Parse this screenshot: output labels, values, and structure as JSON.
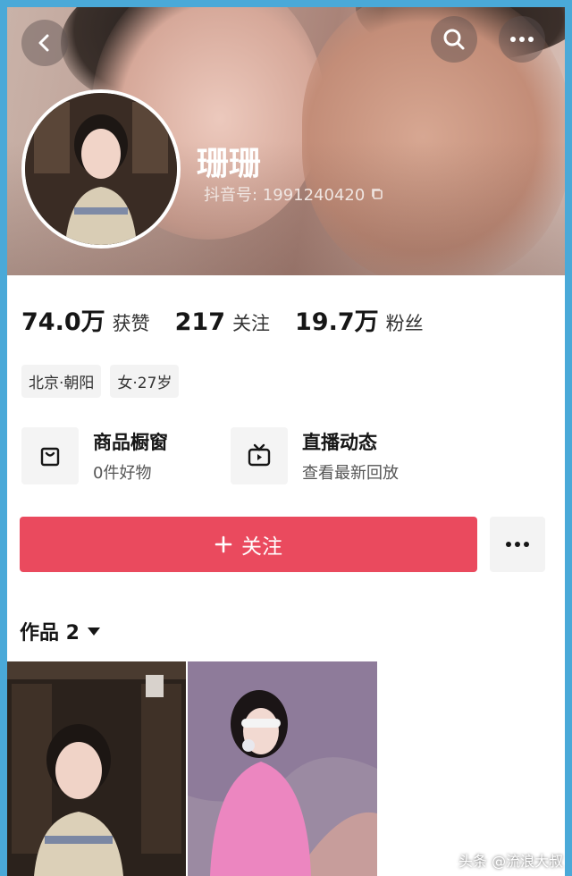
{
  "header": {
    "nickname": "珊珊",
    "douyin_id": "抖音号: 1991240420"
  },
  "stats": [
    {
      "value": "74.0万",
      "label": "获赞"
    },
    {
      "value": "217",
      "label": "关注"
    },
    {
      "value": "19.7万",
      "label": "粉丝"
    }
  ],
  "tags": [
    "北京·朝阳",
    "女·27岁"
  ],
  "features": [
    {
      "title": "商品橱窗",
      "subtitle": "0件好物",
      "icon": "shop-bag-icon"
    },
    {
      "title": "直播动态",
      "subtitle": "查看最新回放",
      "icon": "tv-icon"
    }
  ],
  "follow_button": {
    "label": "关注"
  },
  "works_tab": {
    "label": "作品 2"
  },
  "watermark": "头条 @流浪大叔",
  "colors": {
    "accent": "#ea4a5e",
    "frame": "#4aa9d8"
  }
}
